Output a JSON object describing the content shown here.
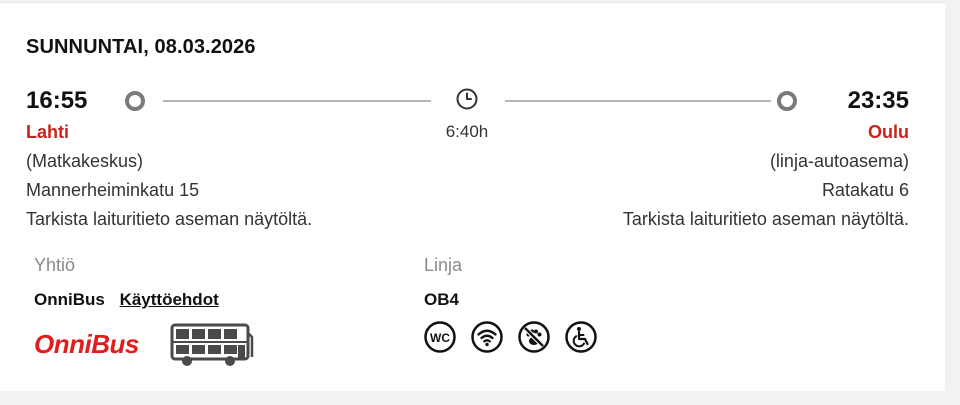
{
  "trip": {
    "date": "SUNNUNTAI, 08.03.2026",
    "duration": "6:40h",
    "departure": {
      "time": "16:55",
      "city": "Lahti",
      "station": "(Matkakeskus)",
      "street": "Mannerheiminkatu 15",
      "note": "Tarkista laituritieto aseman näytöltä."
    },
    "arrival": {
      "time": "23:35",
      "city": "Oulu",
      "station": "(linja-autoasema)",
      "street": "Ratakatu 6",
      "note": "Tarkista laituritieto aseman näytöltä."
    }
  },
  "details": {
    "company_label": "Yhtiö",
    "line_label": "Linja",
    "company_name": "OnniBus",
    "terms_link": "Käyttöehdot",
    "line_code": "OB4",
    "logo_text": "OnniBus"
  },
  "amenities": [
    {
      "icon": "wc-icon"
    },
    {
      "icon": "wifi-icon"
    },
    {
      "icon": "no-pets-icon"
    },
    {
      "icon": "wheelchair-icon"
    }
  ],
  "colors": {
    "brand_red": "#c8241c",
    "logo_red": "#e11d1d",
    "text": "#111111",
    "muted": "#8a8a8a",
    "track": "#b5b5b5"
  }
}
